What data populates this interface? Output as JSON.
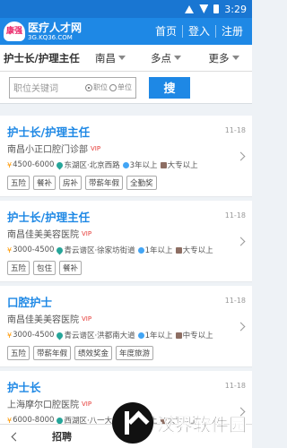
{
  "status": {
    "time": "3:29"
  },
  "header": {
    "logo_mark": "康强",
    "logo_title": "医疗人才网",
    "logo_sub": "3G.KQ36.COM",
    "nav": [
      "首页",
      "登入",
      "注册"
    ]
  },
  "filters": {
    "position": "护士长/护理主任",
    "city": "南昌",
    "sites": "多点",
    "more": "更多"
  },
  "search": {
    "placeholder": "职位关键词",
    "option_job": "职位",
    "option_unit": "单位",
    "button": "搜"
  },
  "jobs": [
    {
      "title": "护士长/护理主任",
      "date": "11-18",
      "company": "南昌小正口腔门诊部",
      "vip": "VIP",
      "salary": "4500-6000",
      "location": "东湖区·北京西路",
      "experience": "3年以上",
      "education": "大专以上",
      "tags": [
        "五险",
        "餐补",
        "房补",
        "带薪年假",
        "全勤奖"
      ]
    },
    {
      "title": "护士长/护理主任",
      "date": "11-18",
      "company": "南昌佳美美容医院",
      "vip": "VIP",
      "salary": "3000-4500",
      "location": "青云谱区·徐家坊街道",
      "experience": "1年以上",
      "education": "大专以上",
      "tags": [
        "五险",
        "包住",
        "餐补"
      ]
    },
    {
      "title": "口腔护士",
      "date": "11-18",
      "company": "南昌佳美美容医院",
      "vip": "VIP",
      "salary": "3000-4500",
      "location": "青云谱区·洪都南大道",
      "experience": "1年以上",
      "education": "中专以上",
      "tags": [
        "五险",
        "带薪年假",
        "绩效奖金",
        "年度旅游"
      ]
    },
    {
      "title": "护士长",
      "date": "11-18",
      "company": "上海摩尔口腔医院",
      "vip": "VIP",
      "salary": "6000-8000",
      "location": "西湖区·八一大道",
      "experience": "3年以上",
      "education": "大专以上",
      "tags": []
    }
  ],
  "bottom": {
    "label": "招聘"
  },
  "watermark": {
    "text": "汉界软件园"
  },
  "colors": {
    "primary": "#1e88e5",
    "vip": "#e53935"
  }
}
